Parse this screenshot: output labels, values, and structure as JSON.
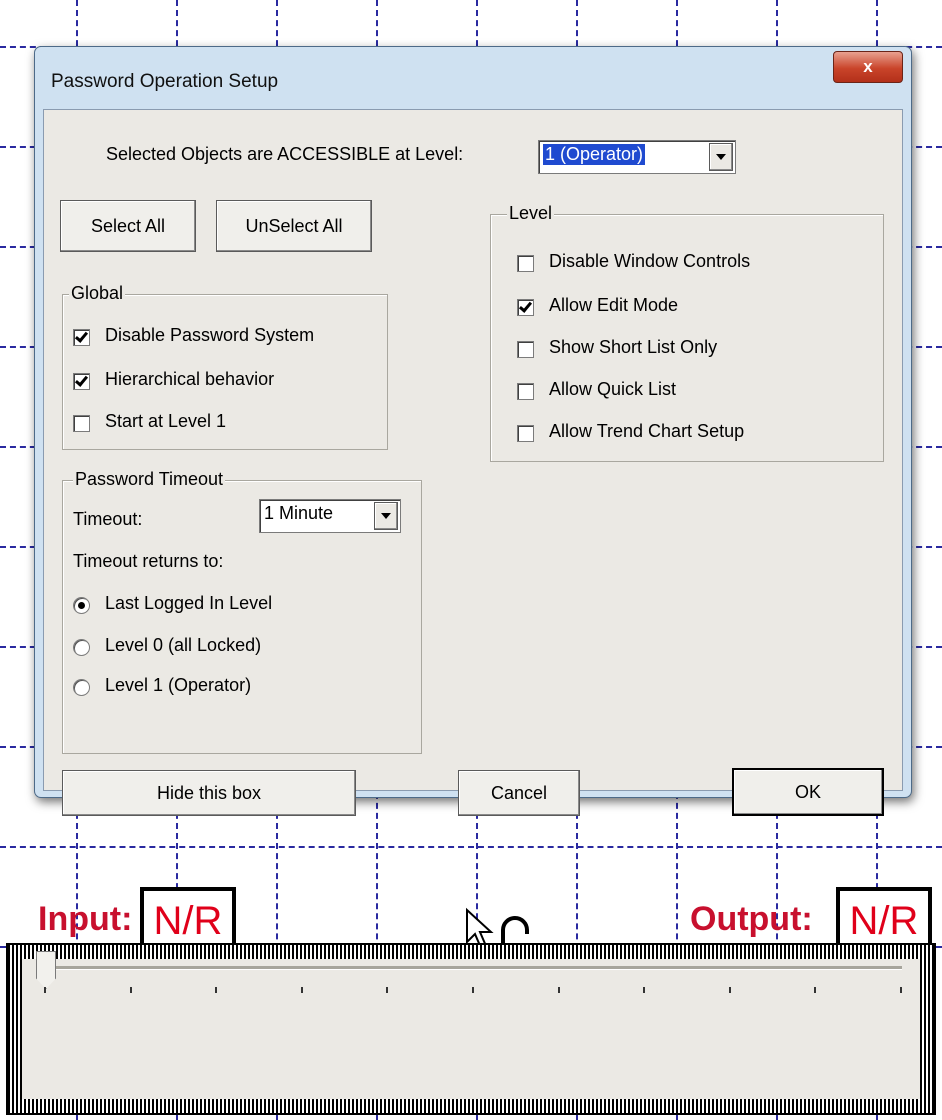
{
  "dialog": {
    "title": "Password Operation Setup",
    "close_label": "x",
    "level_prompt": "Selected Objects are ACCESSIBLE at Level:",
    "level_value": "1 (Operator)",
    "select_all": "Select All",
    "unselect_all": "UnSelect All",
    "global": {
      "title": "Global",
      "items": [
        {
          "label": "Disable Password System",
          "checked": true
        },
        {
          "label": "Hierarchical behavior",
          "checked": true
        },
        {
          "label": "Start at Level 1",
          "checked": false
        }
      ]
    },
    "timeout": {
      "title": "Password Timeout",
      "label": "Timeout:",
      "value": "1 Minute",
      "returns_label": "Timeout returns to:",
      "options": [
        {
          "label": "Last Logged In Level",
          "checked": true
        },
        {
          "label": "Level 0 (all Locked)",
          "checked": false
        },
        {
          "label": "Level 1 (Operator)",
          "checked": false
        }
      ]
    },
    "level": {
      "title": "Level",
      "items": [
        {
          "label": "Disable Window Controls",
          "checked": false
        },
        {
          "label": "Allow Edit Mode",
          "checked": true
        },
        {
          "label": "Show Short List Only",
          "checked": false
        },
        {
          "label": "Allow Quick List",
          "checked": false
        },
        {
          "label": "Allow Trend Chart Setup",
          "checked": false
        }
      ]
    },
    "hide_button": "Hide this box",
    "cancel_button": "Cancel",
    "ok_button": "OK"
  },
  "readouts": {
    "input_label": "Input:",
    "input_value": "N/R",
    "output_label": "Output:",
    "output_value": "N/R"
  },
  "slider": {
    "value_fraction": 0.0,
    "tick_count": 11
  },
  "icons": {
    "lock": "unlocked-padlock-icon",
    "cursor": "arrow-cursor-icon"
  },
  "colors": {
    "grid": "#2a2aa0",
    "readout_red": "#c8102e",
    "selection_blue": "#1f4ad0"
  }
}
